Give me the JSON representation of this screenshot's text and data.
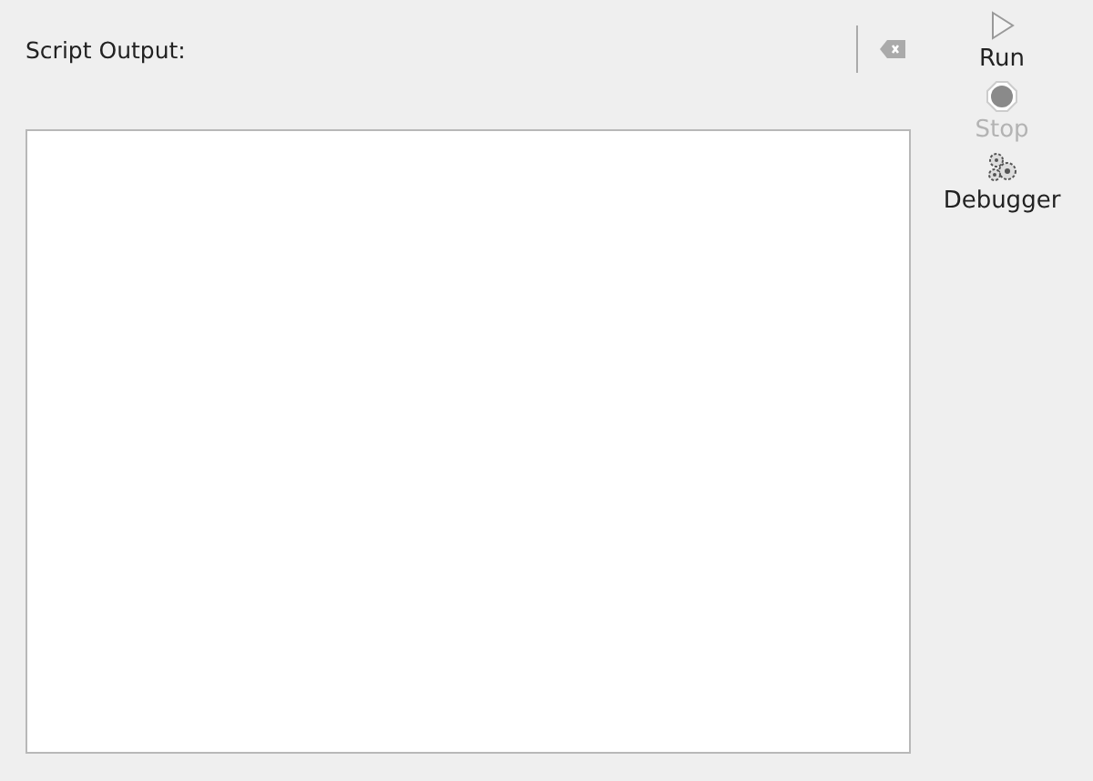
{
  "output_panel": {
    "label": "Script Output:"
  },
  "actions": [
    {
      "kind": "run",
      "label": "Run",
      "disabled": false
    },
    {
      "kind": "stop",
      "label": "Stop",
      "disabled": true
    },
    {
      "kind": "debug",
      "label": "Debugger",
      "disabled": false
    }
  ]
}
